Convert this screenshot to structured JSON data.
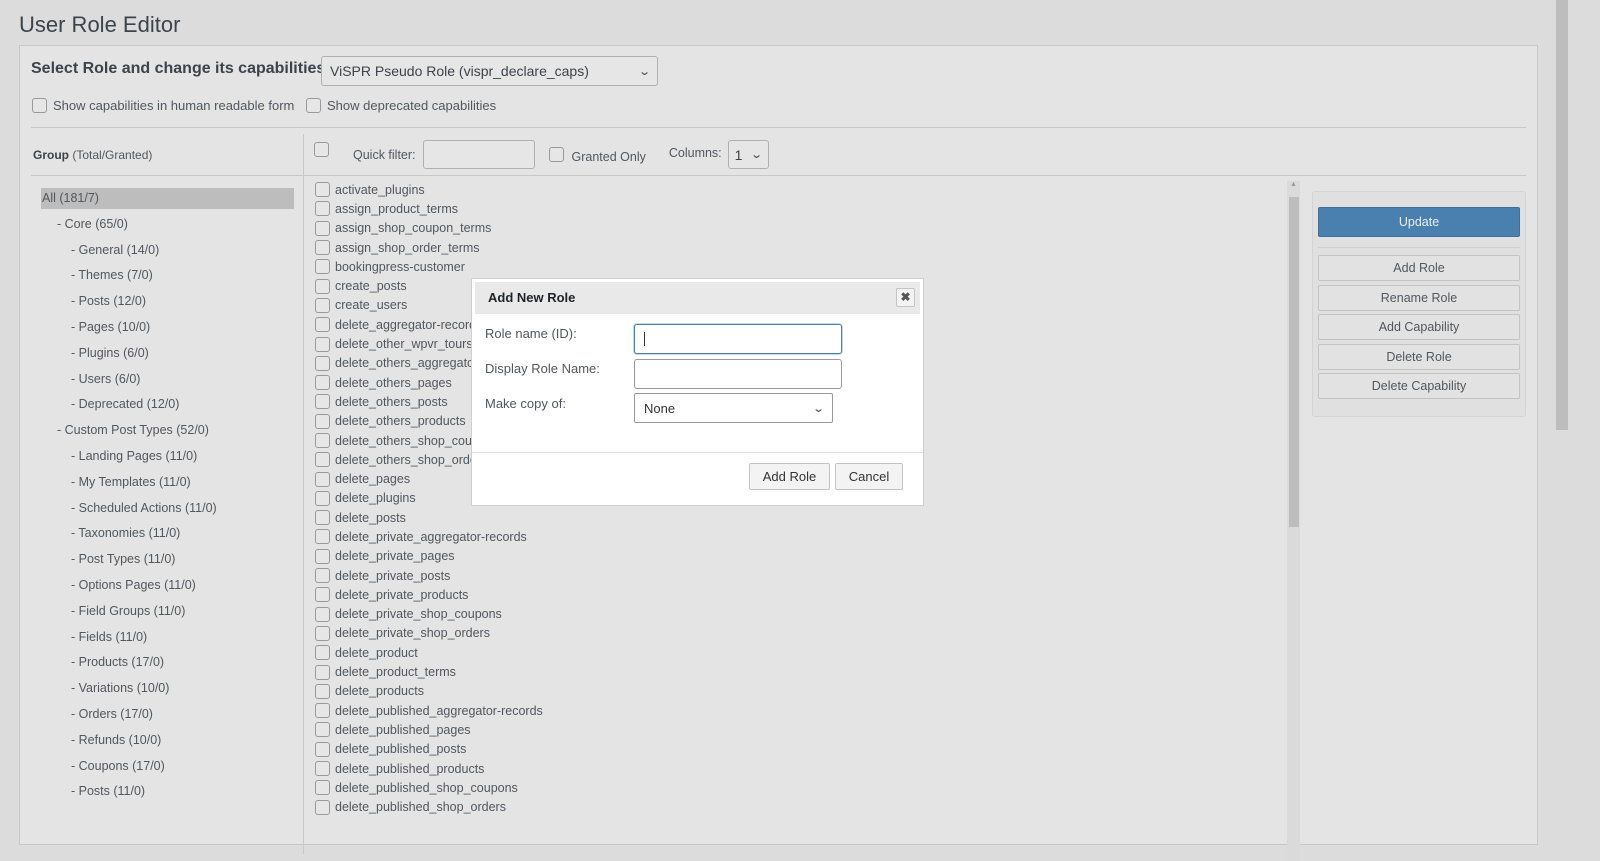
{
  "page_title": "User Role Editor",
  "role_select": {
    "label": "Select Role and change its capabilities:",
    "value": "ViSPR Pseudo Role (vispr_declare_caps)"
  },
  "options": {
    "human_readable": "Show capabilities in human readable form",
    "deprecated": "Show deprecated capabilities"
  },
  "groups_header": {
    "bold": "Group",
    "rest": "(Total/Granted)"
  },
  "groups": [
    {
      "label": "All (181/7)",
      "level": 0,
      "selected": true
    },
    {
      "label": "- Core (65/0)",
      "level": 1
    },
    {
      "label": "- General (14/0)",
      "level": 2
    },
    {
      "label": "- Themes (7/0)",
      "level": 2
    },
    {
      "label": "- Posts (12/0)",
      "level": 2
    },
    {
      "label": "- Pages (10/0)",
      "level": 2
    },
    {
      "label": "- Plugins (6/0)",
      "level": 2
    },
    {
      "label": "- Users (6/0)",
      "level": 2
    },
    {
      "label": "- Deprecated (12/0)",
      "level": 2
    },
    {
      "label": "- Custom Post Types (52/0)",
      "level": 1
    },
    {
      "label": "- Landing Pages (11/0)",
      "level": 2
    },
    {
      "label": "- My Templates (11/0)",
      "level": 2
    },
    {
      "label": "- Scheduled Actions (11/0)",
      "level": 2
    },
    {
      "label": "- Taxonomies (11/0)",
      "level": 2
    },
    {
      "label": "- Post Types (11/0)",
      "level": 2
    },
    {
      "label": "- Options Pages (11/0)",
      "level": 2
    },
    {
      "label": "- Field Groups (11/0)",
      "level": 2
    },
    {
      "label": "- Fields (11/0)",
      "level": 2
    },
    {
      "label": "- Products (17/0)",
      "level": 2
    },
    {
      "label": "- Variations (10/0)",
      "level": 2
    },
    {
      "label": "- Orders (17/0)",
      "level": 2
    },
    {
      "label": "- Refunds (10/0)",
      "level": 2
    },
    {
      "label": "- Coupons (17/0)",
      "level": 2
    },
    {
      "label": "- Posts (11/0)",
      "level": 2
    }
  ],
  "toolbar": {
    "quick_filter": "Quick filter:",
    "quick_filter_value": "",
    "granted_only": "Granted Only",
    "columns_label": "Columns:",
    "columns_value": "1"
  },
  "capabilities": [
    "activate_plugins",
    "assign_product_terms",
    "assign_shop_coupon_terms",
    "assign_shop_order_terms",
    "bookingpress-customer",
    "create_posts",
    "create_users",
    "delete_aggregator-records",
    "delete_other_wpvr_tours",
    "delete_others_aggregator-records",
    "delete_others_pages",
    "delete_others_posts",
    "delete_others_products",
    "delete_others_shop_coupons",
    "delete_others_shop_orders",
    "delete_pages",
    "delete_plugins",
    "delete_posts",
    "delete_private_aggregator-records",
    "delete_private_pages",
    "delete_private_posts",
    "delete_private_products",
    "delete_private_shop_coupons",
    "delete_private_shop_orders",
    "delete_product",
    "delete_product_terms",
    "delete_products",
    "delete_published_aggregator-records",
    "delete_published_pages",
    "delete_published_posts",
    "delete_published_products",
    "delete_published_shop_coupons",
    "delete_published_shop_orders"
  ],
  "actions": {
    "update": "Update",
    "add_role": "Add Role",
    "rename_role": "Rename Role",
    "add_capability": "Add Capability",
    "delete_role": "Delete Role",
    "delete_capability": "Delete Capability"
  },
  "dialog": {
    "title": "Add New Role",
    "role_name_label": "Role name (ID):",
    "role_name_value": "",
    "display_name_label": "Display Role Name:",
    "display_name_value": "",
    "copy_label": "Make copy of:",
    "copy_value": "None",
    "add_button": "Add Role",
    "cancel_button": "Cancel",
    "close_icon": "close-icon"
  },
  "colors": {
    "primary_button": "#4a80b0",
    "background": "#dcdcdc"
  }
}
